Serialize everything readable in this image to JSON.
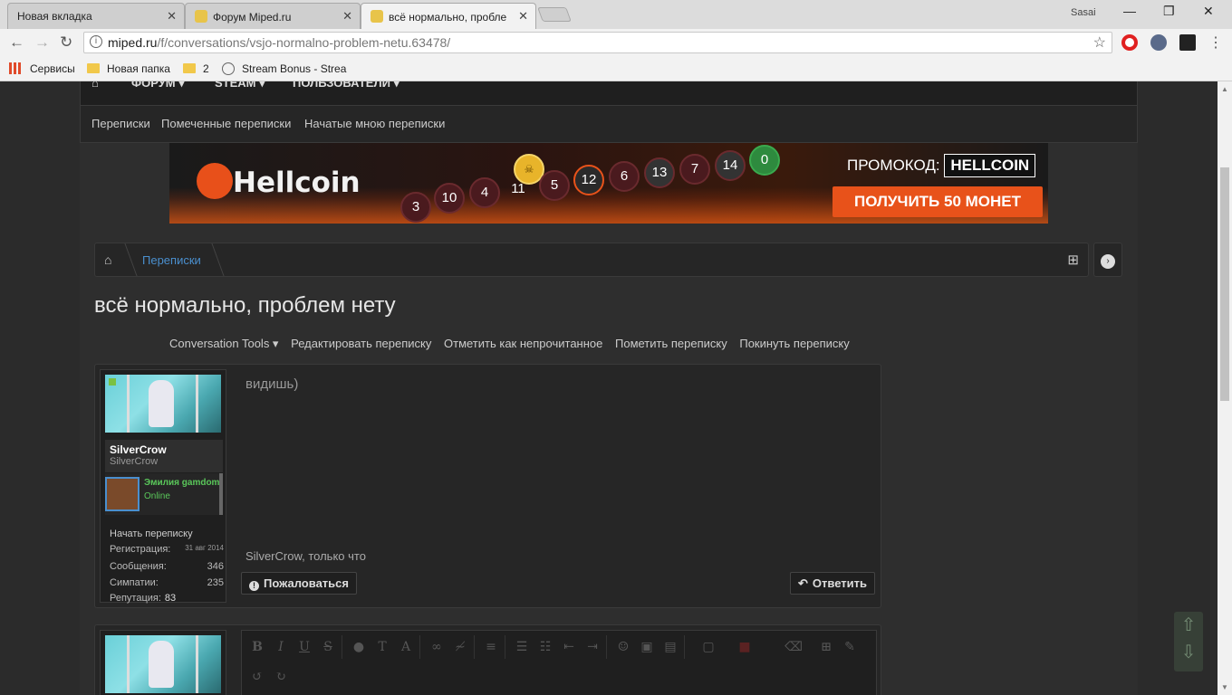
{
  "browser": {
    "tabs": [
      {
        "title": "Новая вкладка",
        "active": false
      },
      {
        "title": "Форум Miped.ru",
        "active": false
      },
      {
        "title": "всё нормально, пробле",
        "active": true
      }
    ],
    "user": "Sasai",
    "url_host": "miped.ru",
    "url_path": "/f/conversations/vsjo-normalno-problem-netu.63478/",
    "bookmarks": [
      "Сервисы",
      "Новая папка",
      "2",
      "Stream Bonus - Strea"
    ]
  },
  "site": {
    "topnav": [
      "ФОРУМ",
      "STEAM",
      "ПОЛЬЗОВАТЕЛИ"
    ],
    "subnav": [
      "Переписки",
      "Помеченные переписки",
      "Начатые мною переписки"
    ]
  },
  "banner": {
    "logo": "Hellcoin",
    "coins": [
      "3",
      "10",
      "4",
      "11",
      "5",
      "12",
      "6",
      "13",
      "7",
      "14",
      "0"
    ],
    "promo_label": "ПРОМОКОД:",
    "promo_code": "HELLCOIN",
    "cta": "ПОЛУЧИТЬ 50 МОНЕТ"
  },
  "breadcrumb": {
    "current": "Переписки"
  },
  "page_title": "всё нормально, проблем нету",
  "tools": [
    "Conversation Tools ▾",
    "Редактировать переписку",
    "Отметить как непрочитанное",
    "Пометить переписку",
    "Покинуть переписку"
  ],
  "message": {
    "author": "SilverCrow",
    "author_title": "SilverCrow",
    "mini_name": "Эмилия gamdom.co",
    "mini_status": "Online",
    "start_conv": "Начать переписку",
    "stats": {
      "reg_label": "Регистрация:",
      "reg_value": "31 авг 2014",
      "posts_label": "Сообщения:",
      "posts_value": "346",
      "likes_label": "Симпатии:",
      "likes_value": "235",
      "rep_label": "Репутация:",
      "rep_value": "83"
    },
    "body": "видишь)",
    "meta": "SilverCrow, только что",
    "report": "Пожаловаться",
    "reply": "Ответить"
  }
}
